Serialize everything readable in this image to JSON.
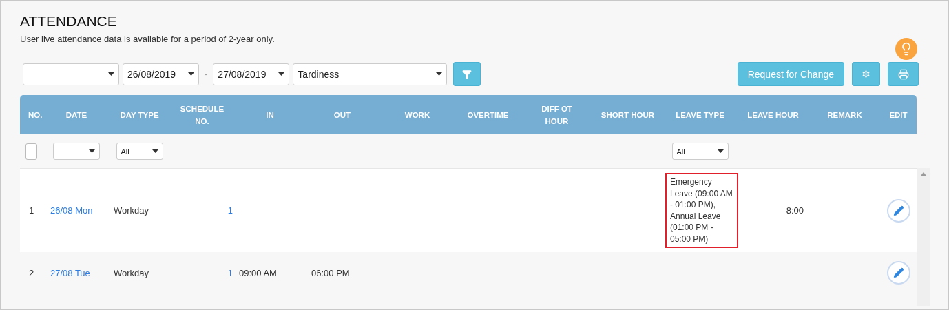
{
  "title": "ATTENDANCE",
  "subtitle": "User live attendance data is available for a period of 2-year only.",
  "toolbar": {
    "filters": [
      {
        "kind": "select"
      },
      {
        "kind": "date",
        "value": "26/08/2019"
      },
      {
        "kind": "separator",
        "text": "-"
      },
      {
        "kind": "date",
        "value": "27/08/2019"
      },
      {
        "kind": "type",
        "value": "Tardiness"
      },
      {
        "kind": "filter-button"
      }
    ],
    "request_button": "Request for Change"
  },
  "table": {
    "columns": [
      "NO.",
      "DATE",
      "DAY TYPE",
      "SCHEDULE NO.",
      "IN",
      "OUT",
      "WORK",
      "OVERTIME",
      "DIFF OT HOUR",
      "SHORT HOUR",
      "LEAVE TYPE",
      "LEAVE HOUR",
      "REMARK",
      "EDIT"
    ],
    "filter_row": {
      "select_all": {
        "checked": false
      },
      "date": {
        "kind": "select"
      },
      "day_type": {
        "kind": "select",
        "value": "All"
      },
      "leave_type": {
        "kind": "select",
        "value": "All"
      }
    },
    "rows": [
      {
        "no": "1",
        "date": "26/08 Mon",
        "day_type": "Workday",
        "schedule_no": "1",
        "leave_type": "Emergency Leave (09:00 AM - 01:00 PM), Annual Leave (01:00 PM - 05:00 PM)",
        "leave_type_flagged": true,
        "leave_hour": "8:00",
        "highlighted": true
      },
      {
        "no": "2",
        "date": "27/08 Tue",
        "day_type": "Workday",
        "schedule_no": "1",
        "in": "09:00 AM",
        "out": "06:00 PM",
        "highlighted": false
      }
    ]
  }
}
